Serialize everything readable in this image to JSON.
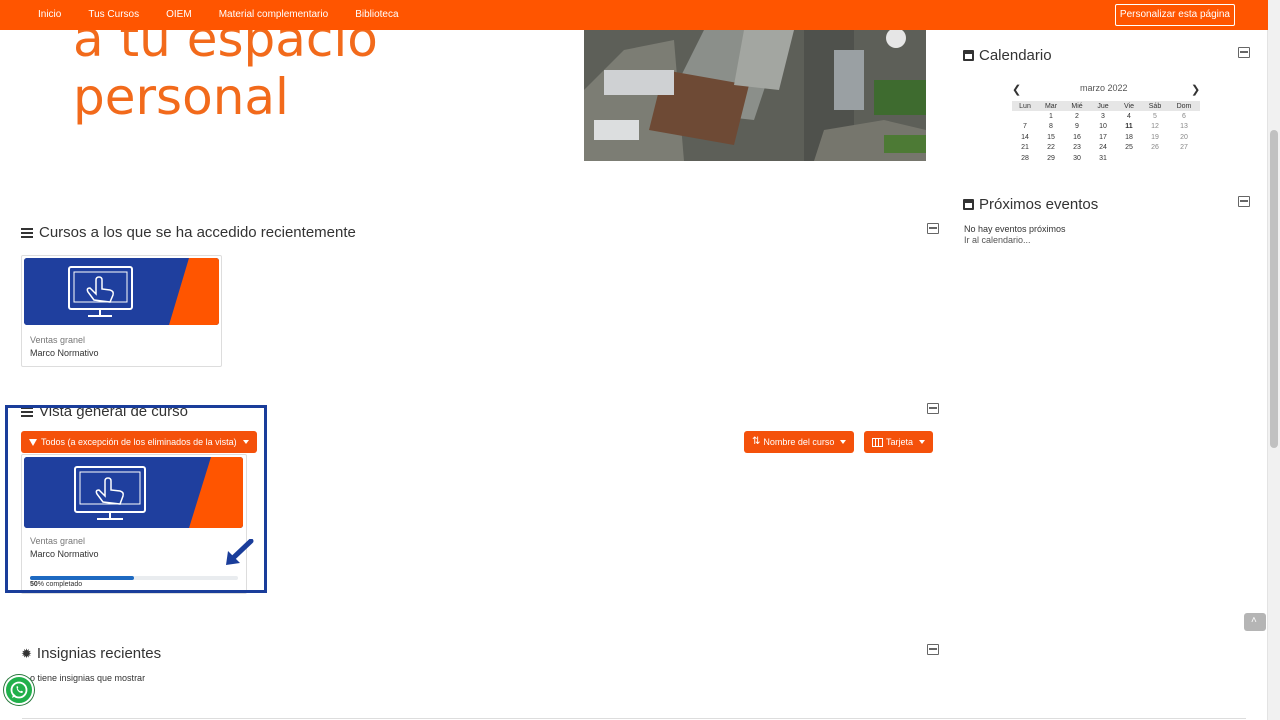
{
  "navbar": {
    "items": [
      "Inicio",
      "Tus Cursos",
      "OIEM",
      "Material complementario",
      "Biblioteca"
    ],
    "customize_label": "Personalizar esta página"
  },
  "banner": {
    "line1": "a tu espacio",
    "line2": "personal"
  },
  "calendar": {
    "title": "Calendario",
    "month_label": "marzo 2022",
    "weekdays": [
      "Lun",
      "Mar",
      "Mié",
      "Jue",
      "Vie",
      "Sáb",
      "Dom"
    ],
    "weeks": [
      [
        "",
        "1",
        "2",
        "3",
        "4",
        "5",
        "6"
      ],
      [
        "7",
        "8",
        "9",
        "10",
        "11",
        "12",
        "13"
      ],
      [
        "14",
        "15",
        "16",
        "17",
        "18",
        "19",
        "20"
      ],
      [
        "21",
        "22",
        "23",
        "24",
        "25",
        "26",
        "27"
      ],
      [
        "28",
        "29",
        "30",
        "31",
        "",
        "",
        ""
      ]
    ]
  },
  "upcoming": {
    "title": "Próximos eventos",
    "empty_text": "No hay eventos próximos",
    "link": "Ir al calendario..."
  },
  "recent_courses": {
    "title": "Cursos a los que se ha accedido recientemente",
    "course": {
      "category": "Ventas granel",
      "name": "Marco Normativo"
    }
  },
  "overview": {
    "title": "Vista general de curso",
    "filter_label": "Todos (a excepción de los eliminados de la vista)",
    "sort_label": "Nombre del curso",
    "view_label": "Tarjeta",
    "course": {
      "category": "Ventas granel",
      "name": "Marco Normativo",
      "progress_percent": 50,
      "progress_value": "50",
      "progress_suffix": "% completado"
    }
  },
  "badges": {
    "title": "Insignias recientes",
    "empty_text": "o tiene insignias que mostrar"
  },
  "colors": {
    "brand_orange": "#ff5500",
    "course_blue": "#1f3f9e",
    "progress_blue": "#1d69c1"
  }
}
